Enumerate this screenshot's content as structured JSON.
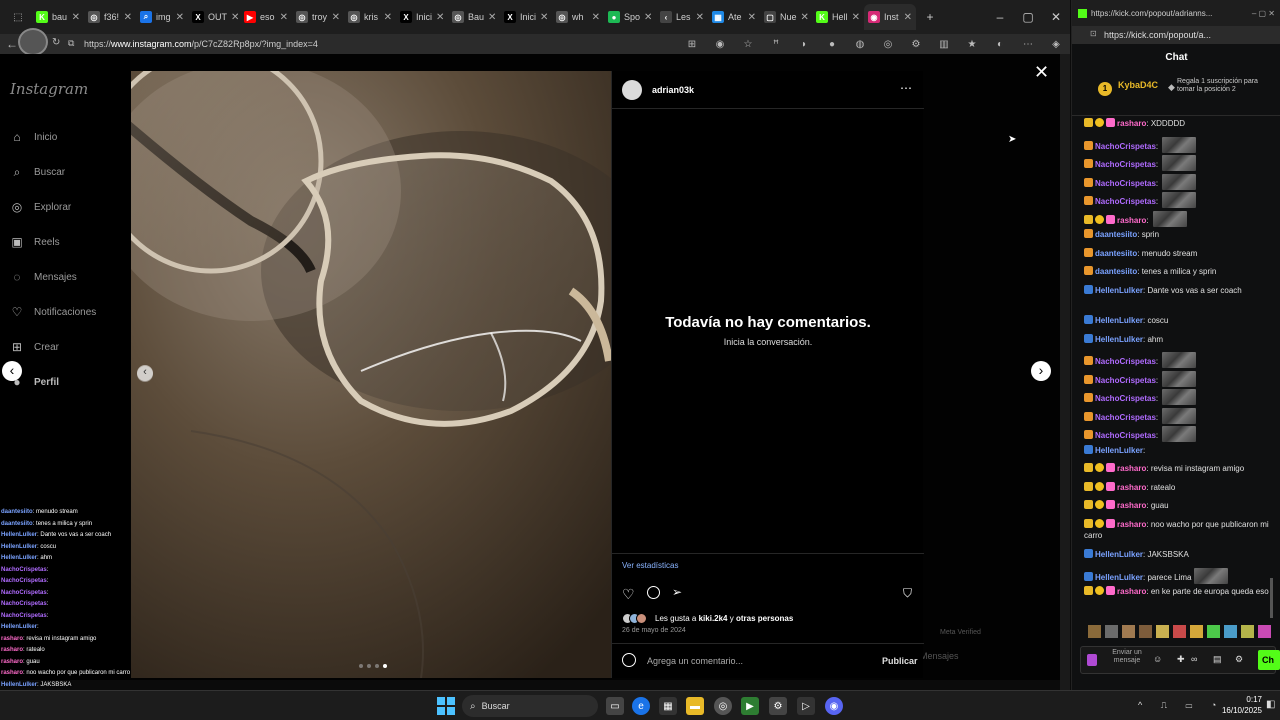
{
  "browser": {
    "tabs": [
      {
        "label": "bau",
        "fav": "K",
        "color": "#53fc18"
      },
      {
        "label": "f36!",
        "fav": "◎",
        "color": "#555"
      },
      {
        "label": "img",
        "fav": "⌕",
        "color": "#1a73e8"
      },
      {
        "label": "OUT",
        "fav": "X",
        "color": "#000"
      },
      {
        "label": "eso",
        "fav": "▶",
        "color": "#ff0000"
      },
      {
        "label": "troy",
        "fav": "◎",
        "color": "#555"
      },
      {
        "label": "kris",
        "fav": "◎",
        "color": "#555"
      },
      {
        "label": "Inici",
        "fav": "X",
        "color": "#000"
      },
      {
        "label": "Bau",
        "fav": "◎",
        "color": "#555"
      },
      {
        "label": "Inici",
        "fav": "X",
        "color": "#000"
      },
      {
        "label": "wh",
        "fav": "◎",
        "color": "#555"
      },
      {
        "label": "Spo",
        "fav": "●",
        "color": "#1db954"
      },
      {
        "label": "Les",
        "fav": "‹",
        "color": "#444"
      },
      {
        "label": "Ate",
        "fav": "▦",
        "color": "#1e88e5"
      },
      {
        "label": "Nue",
        "fav": "▢",
        "color": "#444"
      },
      {
        "label": "Hell",
        "fav": "K",
        "color": "#53fc18"
      },
      {
        "label": "Inst",
        "fav": "◉",
        "color": "#d62976"
      }
    ],
    "url_prefix": "https://",
    "url_host": "www.instagram.com",
    "url_path": "/p/C7cZ82Rp8px/?img_index=4"
  },
  "instagram": {
    "logo": "Instagram",
    "nav": [
      {
        "label": "Inicio",
        "icon": "home-icon"
      },
      {
        "label": "Buscar",
        "icon": "search-icon"
      },
      {
        "label": "Explorar",
        "icon": "compass-icon"
      },
      {
        "label": "Reels",
        "icon": "reels-icon"
      },
      {
        "label": "Mensajes",
        "icon": "messages-icon"
      },
      {
        "label": "Notificaciones",
        "icon": "heart-icon"
      },
      {
        "label": "Crear",
        "icon": "plus-icon"
      },
      {
        "label": "Perfil",
        "icon": "avatar-icon"
      }
    ],
    "post": {
      "username": "adrian03k",
      "no_comments_title": "Todavía no hay comentarios.",
      "no_comments_sub": "Inicia la conversación.",
      "stats_link": "Ver estadísticas",
      "likes_prefix": "Les gusta a ",
      "likes_user": "kiki.2k4",
      "likes_mid": " y ",
      "likes_others": "otras personas",
      "date": "26 de mayo de 2024",
      "comment_placeholder": "Agrega un comentario...",
      "publish_label": "Publicar"
    },
    "behind": {
      "meta_verified": "Meta Verified",
      "mensajes": "Mensajes"
    }
  },
  "kick": {
    "url": "https://kick.com/popout/adrianns...",
    "url_full": "https://kick.com/popout/a...",
    "title": "Chat",
    "pinned_user": "KybaD4C",
    "pinned_count": "1",
    "pinned_text": "Regala 1 suscripción para tomar la posición 2",
    "input_placeholder": "Enviar un mensaje",
    "send_label": "Ch",
    "messages": [
      {
        "user": "rasharo",
        "color": "#ff6bcb",
        "text": "XDDDDD",
        "emote": false
      },
      {
        "user": "NachoCrispetas",
        "color": "#b06bff",
        "text": "",
        "emote": true
      },
      {
        "user": "NachoCrispetas",
        "color": "#b06bff",
        "text": "",
        "emote": true
      },
      {
        "user": "NachoCrispetas",
        "color": "#b06bff",
        "text": "",
        "emote": true
      },
      {
        "user": "NachoCrispetas",
        "color": "#b06bff",
        "text": "",
        "emote": true
      },
      {
        "user": "rasharo",
        "color": "#ff6bcb",
        "text": "",
        "emote": true
      },
      {
        "user": "daantesiito",
        "color": "#7aa2ff",
        "text": "sprin",
        "emote": false
      },
      {
        "user": "daantesiito",
        "color": "#7aa2ff",
        "text": "menudo stream",
        "emote": false
      },
      {
        "user": "daantesiito",
        "color": "#7aa2ff",
        "text": "tenes a milica y sprin",
        "emote": false
      },
      {
        "user": "HellenLulker",
        "color": "#7aa2ff",
        "text": "Dante vos vas a ser coach",
        "emote": false
      },
      {
        "user": "HellenLulker",
        "color": "#7aa2ff",
        "text": "coscu",
        "emote": false
      },
      {
        "user": "HellenLulker",
        "color": "#7aa2ff",
        "text": "ahm",
        "emote": false
      },
      {
        "user": "NachoCrispetas",
        "color": "#b06bff",
        "text": "",
        "emote": true
      },
      {
        "user": "NachoCrispetas",
        "color": "#b06bff",
        "text": "",
        "emote": true
      },
      {
        "user": "NachoCrispetas",
        "color": "#b06bff",
        "text": "",
        "emote": true
      },
      {
        "user": "NachoCrispetas",
        "color": "#b06bff",
        "text": "",
        "emote": true
      },
      {
        "user": "NachoCrispetas",
        "color": "#b06bff",
        "text": "",
        "emote": true
      },
      {
        "user": "HellenLulker",
        "color": "#7aa2ff",
        "text": "",
        "emote": false
      },
      {
        "user": "rasharo",
        "color": "#ff6bcb",
        "text": "revisa mi instagram amigo",
        "emote": false
      },
      {
        "user": "rasharo",
        "color": "#ff6bcb",
        "text": "ratealo",
        "emote": false
      },
      {
        "user": "rasharo",
        "color": "#ff6bcb",
        "text": "guau",
        "emote": false
      },
      {
        "user": "rasharo",
        "color": "#ff6bcb",
        "text": "noo wacho por que publicaron mi carro",
        "emote": false
      },
      {
        "user": "HellenLulker",
        "color": "#7aa2ff",
        "text": "JAKSBSKA",
        "emote": false
      },
      {
        "user": "HellenLulker",
        "color": "#7aa2ff",
        "text": "parece Lima",
        "emote": true
      },
      {
        "user": "rasharo",
        "color": "#ff6bcb",
        "text": "en ke parte de europa queda eso",
        "emote": false
      }
    ]
  },
  "overlay_chat": [
    {
      "user": "daantesiito",
      "color": "#7aa2ff",
      "text": "menudo stream"
    },
    {
      "user": "daantesiito",
      "color": "#7aa2ff",
      "text": "tenes a milica y sprin"
    },
    {
      "user": "HellenLulker",
      "color": "#7aa2ff",
      "text": "Dante vos vas a ser coach"
    },
    {
      "user": "HellenLulker",
      "color": "#7aa2ff",
      "text": "coscu"
    },
    {
      "user": "HellenLulker",
      "color": "#7aa2ff",
      "text": "ahm"
    },
    {
      "user": "NachoCrispetas",
      "color": "#b06bff",
      "text": ""
    },
    {
      "user": "NachoCrispetas",
      "color": "#b06bff",
      "text": ""
    },
    {
      "user": "NachoCrispetas",
      "color": "#b06bff",
      "text": ""
    },
    {
      "user": "NachoCrispetas",
      "color": "#b06bff",
      "text": ""
    },
    {
      "user": "NachoCrispetas",
      "color": "#b06bff",
      "text": ""
    },
    {
      "user": "HellenLulker",
      "color": "#7aa2ff",
      "text": ""
    },
    {
      "user": "rasharo",
      "color": "#ff6bcb",
      "text": "revisa mi instagram amigo"
    },
    {
      "user": "rasharo",
      "color": "#ff6bcb",
      "text": "ratealo"
    },
    {
      "user": "rasharo",
      "color": "#ff6bcb",
      "text": "guau"
    },
    {
      "user": "rasharo",
      "color": "#ff6bcb",
      "text": "noo wacho por que publicaron mi carro"
    },
    {
      "user": "HellenLulker",
      "color": "#7aa2ff",
      "text": "JAKSBSKA"
    },
    {
      "user": "HellenLulker",
      "color": "#7aa2ff",
      "text": "parece Lima"
    },
    {
      "user": "rasharo",
      "color": "#ff6bcb",
      "text": "en ke parte de europa queda eso"
    }
  ],
  "taskbar": {
    "search_label": "Buscar",
    "time": "0:17",
    "date": "16/10/2025"
  }
}
